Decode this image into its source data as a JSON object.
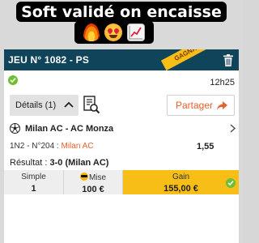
{
  "caption": {
    "text": "Soft validé on encaisse",
    "emojis": [
      "fire-icon",
      "heart-eyes-icon",
      "chart-increasing-icon"
    ]
  },
  "ticket": {
    "title": "JEU N° 1082 - PS",
    "ribbon": "GAGNANT",
    "time": "12h25",
    "details_label": "Détails (1)",
    "share_label": "Partager",
    "match": "Milan AC - AC Monza",
    "bet_code": "1N2 - N°204 : ",
    "bet_pick": "Milan AC",
    "odds": "1,55",
    "result_label": "Résultat : ",
    "result_score": "3-0",
    "result_team": " (Milan AC)"
  },
  "summary": {
    "type_label": "Simple",
    "type_value": "1",
    "stake_label": "Mise",
    "stake_value": "100 €",
    "gain_label": "Gain",
    "gain_value": "155,00 €"
  },
  "colors": {
    "header": "#10445a",
    "ribbon": "#f7be17",
    "accent_orange": "#e8602c",
    "win_green": "#6fbf35",
    "gain_yellow": "#f7be17"
  }
}
